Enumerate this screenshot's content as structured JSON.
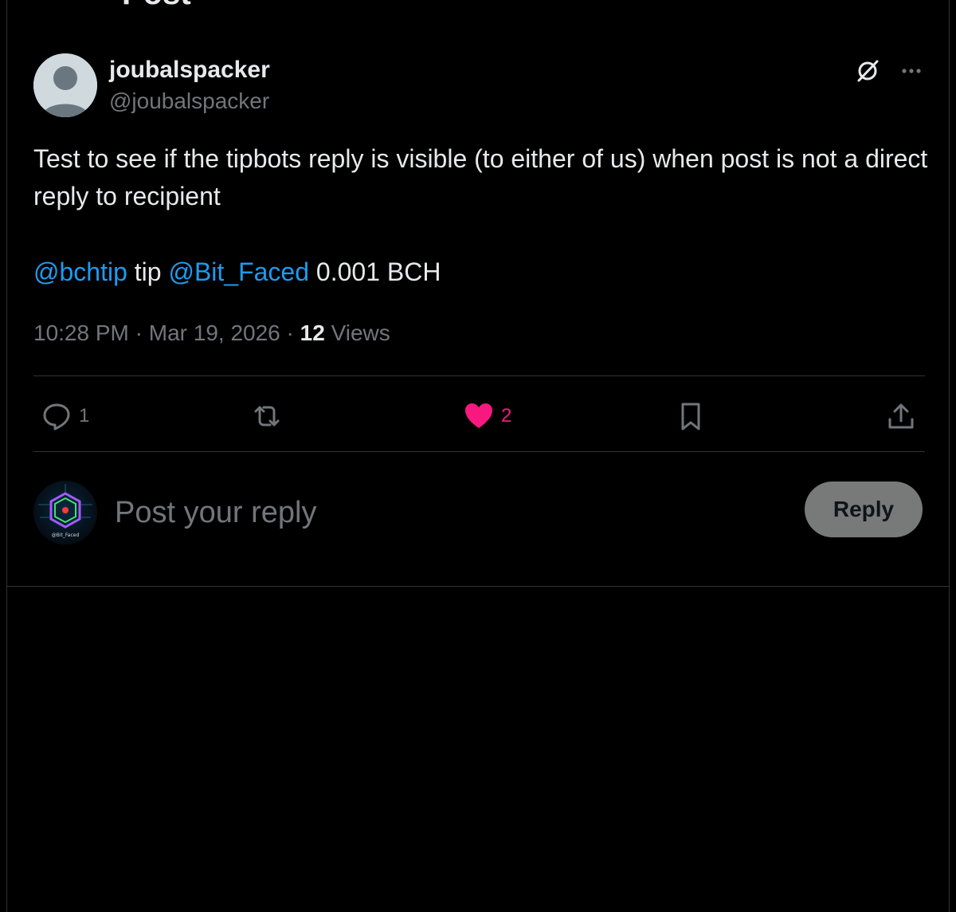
{
  "header": {
    "title": "Post"
  },
  "post": {
    "author": {
      "display_name": "joubalspacker",
      "handle": "@joubalspacker"
    },
    "text_line": "Test to see if the tipbots reply is visible (to either of us) when post is not a direct reply to recipient",
    "command": {
      "mention_1": "@bchtip",
      "word": " tip ",
      "mention_2": "@Bit_Faced",
      "amount": " 0.001 BCH"
    },
    "time": "10:28 PM",
    "separator_1": " · ",
    "date": "Mar 19, 2026",
    "separator_2": " · ",
    "views_count": "12",
    "views_label": " Views"
  },
  "actions": {
    "reply_count": "1",
    "repost_count": "",
    "like_count": "2",
    "like_color": "#f91880"
  },
  "composer": {
    "placeholder": "Post your reply",
    "avatar_label": "@Bit_Faced",
    "button_label": "Reply"
  },
  "colors": {
    "link": "#1d9bf0",
    "secondary_text": "#71767b",
    "background": "#000000"
  }
}
